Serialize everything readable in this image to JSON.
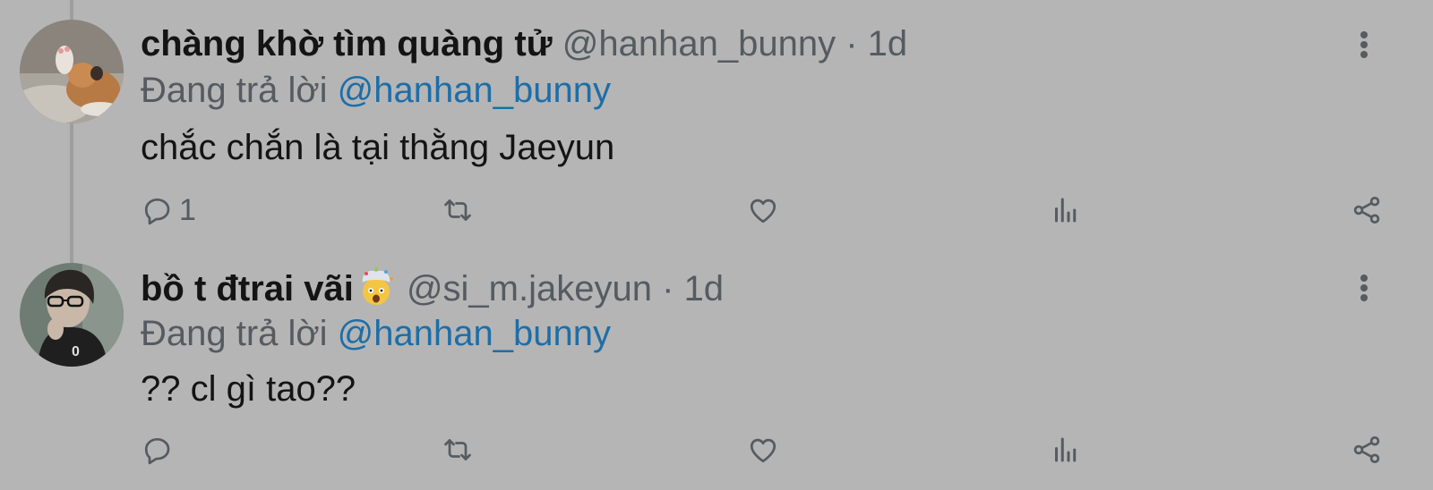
{
  "tweets": [
    {
      "display_name": "chàng khờ tìm quàng tử",
      "handle": "@hanhan_bunny",
      "separator": "·",
      "time": "1d",
      "reply_prefix": "Đang trả lời",
      "reply_to": "@hanhan_bunny",
      "text": "chắc chắn là tại thằng Jaeyun",
      "reply_count": "1",
      "avatar": "cat-avatar"
    },
    {
      "display_name": "bồ t đtrai vãi",
      "name_emoji": "exploding-head-emoji",
      "handle": "@si_m.jakeyun",
      "separator": "·",
      "time": "1d",
      "reply_prefix": "Đang trả lời",
      "reply_to": "@hanhan_bunny",
      "text": "?? cl gì tao??",
      "reply_count": "",
      "avatar": "person-glasses-avatar"
    }
  ],
  "colors": {
    "background": "#b5b5b5",
    "text": "#141414",
    "secondary": "#555b61",
    "mention": "#1d6ea8"
  },
  "icons": [
    "reply-icon",
    "retweet-icon",
    "like-icon",
    "views-icon",
    "share-icon",
    "more-icon"
  ]
}
